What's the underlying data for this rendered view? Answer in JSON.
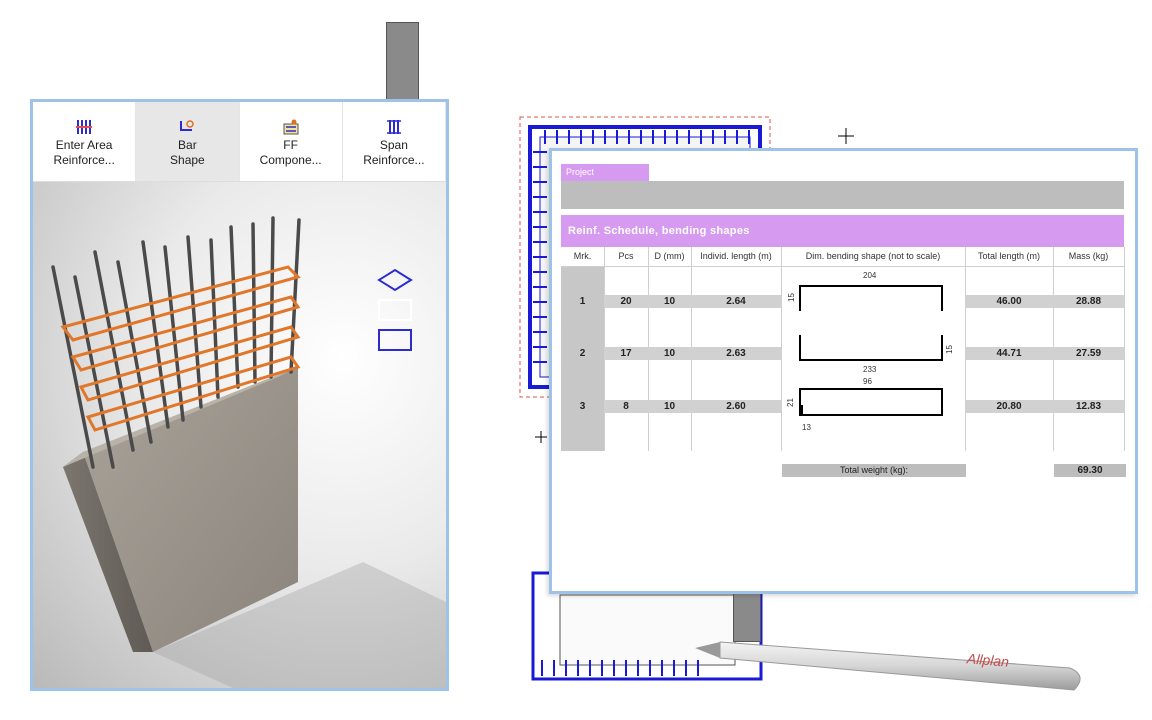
{
  "toolbar": {
    "items": [
      {
        "label": "Enter Area\nReinforce...",
        "icon": "rebar-area-icon"
      },
      {
        "label": "Bar\nShape",
        "icon": "bar-shape-icon"
      },
      {
        "label": "FF\nCompone...",
        "icon": "ff-component-icon"
      },
      {
        "label": "Span\nReinforce...",
        "icon": "span-reinforce-icon"
      }
    ],
    "active_index": 1
  },
  "sheet": {
    "project_label": "Project",
    "schedule_title": "Reinf. Schedule,  bending shapes",
    "columns": [
      "Mrk.",
      "Pcs",
      "D (mm)",
      "Individ. length (m)",
      "Dim. bending shape (not to scale)",
      "Total length (m)",
      "Mass (kg)"
    ],
    "rows": [
      {
        "mrk": "1",
        "pcs": "20",
        "d": "10",
        "length": "2.64",
        "total_length": "46.00",
        "mass": "28.88",
        "dims": [
          "204",
          "15"
        ]
      },
      {
        "mrk": "2",
        "pcs": "17",
        "d": "10",
        "length": "2.63",
        "total_length": "44.71",
        "mass": "27.59",
        "dims": [
          "233",
          "15"
        ]
      },
      {
        "mrk": "3",
        "pcs": "8",
        "d": "10",
        "length": "2.60",
        "total_length": "20.80",
        "mass": "12.83",
        "dims": [
          "96",
          "21",
          "13"
        ]
      }
    ],
    "total_weight_label": "Total weight      (kg):",
    "total_weight_value": "69.30"
  },
  "brand_text": "Allplan",
  "colors": {
    "accent_border": "#9ec3e6",
    "schedule_header": "#d69bf0",
    "rebar": "#e0772a",
    "drawing_blue": "#1a1ad6"
  }
}
